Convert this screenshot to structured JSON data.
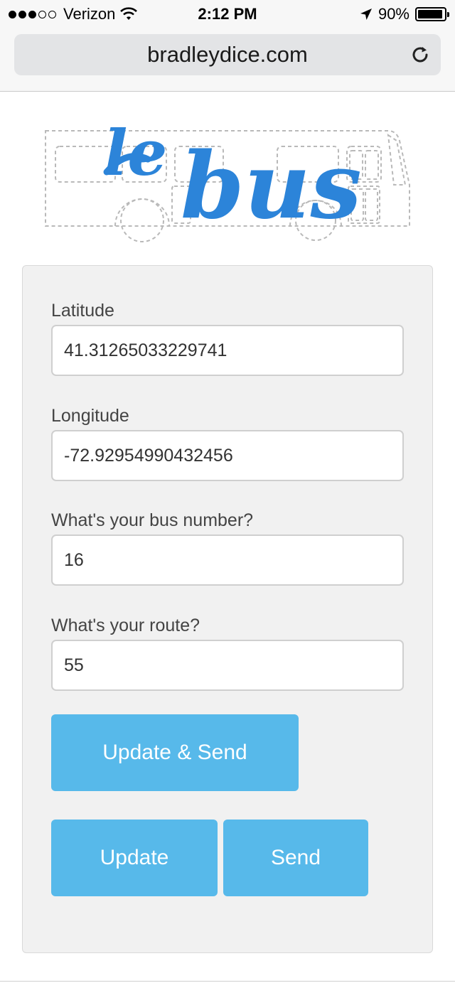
{
  "status_bar": {
    "carrier": "Verizon",
    "time": "2:12 PM",
    "battery": "90%",
    "signal_bars_filled": 3,
    "signal_bars_total": 5,
    "battery_level": 0.9,
    "icons": [
      "signal-dots-icon",
      "wifi-icon",
      "location-arrow-icon",
      "battery-icon"
    ]
  },
  "browser": {
    "url": "bradleydice.com",
    "reload_icon": "reload-icon"
  },
  "logo": {
    "text_le": "le",
    "text_bus": "bus",
    "color": "#2c84d9"
  },
  "form": {
    "latitude": {
      "label": "Latitude",
      "value": "41.31265033229741"
    },
    "longitude": {
      "label": "Longitude",
      "value": "-72.92954990432456"
    },
    "bus_number": {
      "label": "What's your bus number?",
      "value": "16"
    },
    "route": {
      "label": "What's your route?",
      "value": "55"
    },
    "buttons": {
      "update_send": "Update & Send",
      "update": "Update",
      "send": "Send"
    }
  },
  "colors": {
    "button": "#57b9ea",
    "panel": "#f1f1f1",
    "logo_blue": "#2c84d9",
    "logo_outline": "#b9b9b9"
  }
}
